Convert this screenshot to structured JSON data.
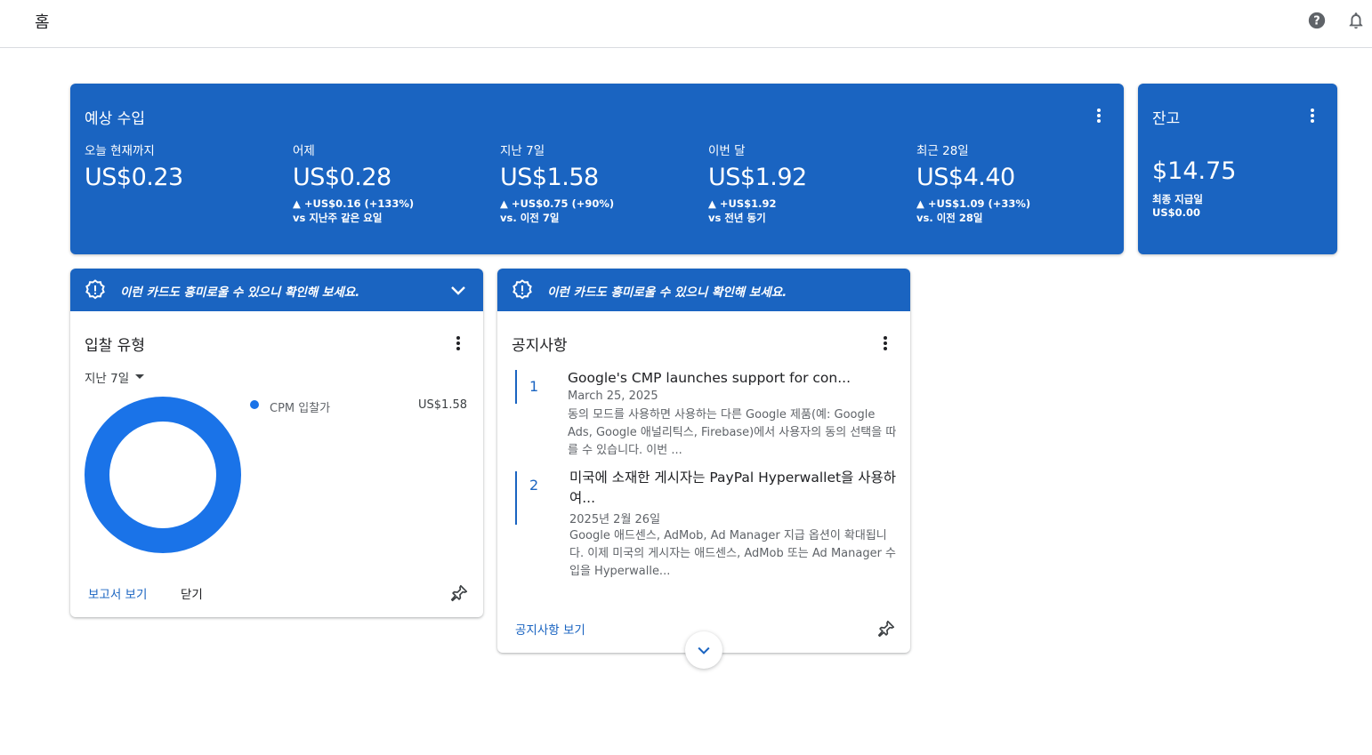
{
  "header": {
    "title": "홈"
  },
  "estimated_earnings": {
    "title": "예상 수입",
    "metrics": [
      {
        "label": "오늘 현재까지",
        "value": "US$0.23",
        "delta": "",
        "compare": ""
      },
      {
        "label": "어제",
        "value": "US$0.28",
        "delta": "▲ +US$0.16 (+133%)",
        "compare": "vs 지난주 같은 요일"
      },
      {
        "label": "지난 7일",
        "value": "US$1.58",
        "delta": "▲ +US$0.75 (+90%)",
        "compare": "vs. 이전 7일"
      },
      {
        "label": "이번 달",
        "value": "US$1.92",
        "delta": "▲ +US$1.92",
        "compare": "vs 전년 동기"
      },
      {
        "label": "최근 28일",
        "value": "US$4.40",
        "delta": "▲ +US$1.09 (+33%)",
        "compare": "vs. 이전 28일"
      }
    ]
  },
  "balance": {
    "title": "잔고",
    "value": "$14.75",
    "last_payment_label": "최종 지급일",
    "last_payment_value": "US$0.00"
  },
  "bid_card": {
    "banner": "이런 카드도 흥미로울 수 있으니 확인해 보세요.",
    "title": "입찰 유형",
    "period": "지난 7일",
    "legend_label": "CPM 입찰가",
    "legend_value": "US$1.58",
    "report_link": "보고서 보기",
    "close_label": "닫기"
  },
  "chart_data": {
    "type": "pie",
    "categories": [
      "CPM 입찰가"
    ],
    "values": [
      1.58
    ],
    "colors": [
      "#1a73e8"
    ],
    "donut": true,
    "legend": "right"
  },
  "notice_card": {
    "banner": "이런 카드도 흥미로울 수 있으니 확인해 보세요.",
    "title": "공지사항",
    "items": [
      {
        "num": "1",
        "title": "Google's CMP launches support for con...",
        "date": "March 25, 2025",
        "body": "동의 모드를 사용하면 사용하는 다른 Google 제품(예: Google Ads, Google 애널리틱스, Firebase)에서 사용자의 동의 선택을 따를 수 있습니다. 이번 ..."
      },
      {
        "num": "2",
        "title": "미국에 소재한 게시자는 PayPal Hyperwallet을 사용하여...",
        "date": "2025년 2월 26일",
        "body": "Google 애드센스, AdMob, Ad Manager 지급 옵션이 확대됩니다. 이제 미국의 게시자는 애드센스, AdMob 또는 Ad Manager 수입을 Hyperwalle..."
      }
    ],
    "view_link": "공지사항 보기"
  },
  "icons": {
    "help": "help-circle-icon",
    "notifications": "bell-icon",
    "more": "more-vert-icon",
    "banner": "badge-alert-icon",
    "expand": "chevron-down-icon",
    "pin": "pin-icon"
  },
  "colors": {
    "accent": "#1a64c1",
    "chart": "#1a73e8"
  }
}
